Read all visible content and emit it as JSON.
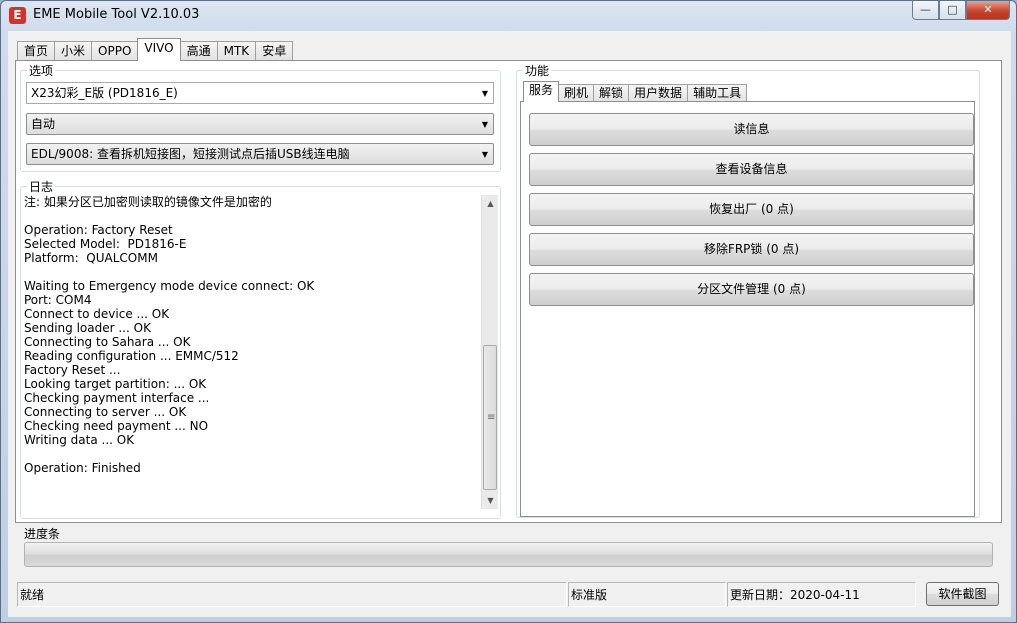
{
  "window": {
    "title": "EME Mobile Tool V2.10.03",
    "icon_letter": "E",
    "minimize": "—",
    "maximize": "□",
    "close": "✕"
  },
  "main_tabs": [
    {
      "label": "首页"
    },
    {
      "label": "小米"
    },
    {
      "label": "OPPO"
    },
    {
      "label": "VIVO",
      "active": true
    },
    {
      "label": "高通"
    },
    {
      "label": "MTK"
    },
    {
      "label": "安卓"
    }
  ],
  "options": {
    "group_label": "选项",
    "model_value": "X23幻彩_E版 (PD1816_E)",
    "mode_value": "自动",
    "edl_value": "EDL/9008: 查看拆机短接图，短接测试点后插USB线连电脑"
  },
  "log": {
    "group_label": "日志",
    "lines": [
      "注: 如果分区已加密则读取的镜像文件是加密的",
      "",
      "Operation: Factory Reset",
      "Selected Model:  PD1816-E",
      "Platform:  QUALCOMM",
      "",
      "Waiting to Emergency mode device connect: OK",
      "Port: COM4",
      "Connect to device ... OK",
      "Sending loader ... OK",
      "Connecting to Sahara ... OK",
      "Reading configuration ... EMMC/512",
      "Factory Reset ...",
      "Looking target partition: ... OK",
      "Checking payment interface ...",
      "Connecting to server ... OK",
      "Checking need payment ... NO",
      "Writing data ... OK",
      "",
      "Operation: Finished"
    ]
  },
  "functions": {
    "group_label": "功能",
    "tabs": [
      {
        "label": "服务",
        "active": true
      },
      {
        "label": "刷机"
      },
      {
        "label": "解锁"
      },
      {
        "label": "用户数据"
      },
      {
        "label": "辅助工具"
      }
    ],
    "buttons": [
      {
        "label": "读信息"
      },
      {
        "label": "查看设备信息"
      },
      {
        "label": "恢复出厂 (0 点)"
      },
      {
        "label": "移除FRP锁 (0 点)"
      },
      {
        "label": "分区文件管理 (0 点)"
      }
    ]
  },
  "progress": {
    "label": "进度条",
    "value": 0
  },
  "status": {
    "state": "就绪",
    "edition": "标准版",
    "update_date": "更新日期：2020-04-11",
    "screenshot_button": "软件截图"
  },
  "colors": {
    "progress_fill": "#2fb344",
    "close_button": "#c7472f",
    "app_icon": "#d0342c"
  }
}
